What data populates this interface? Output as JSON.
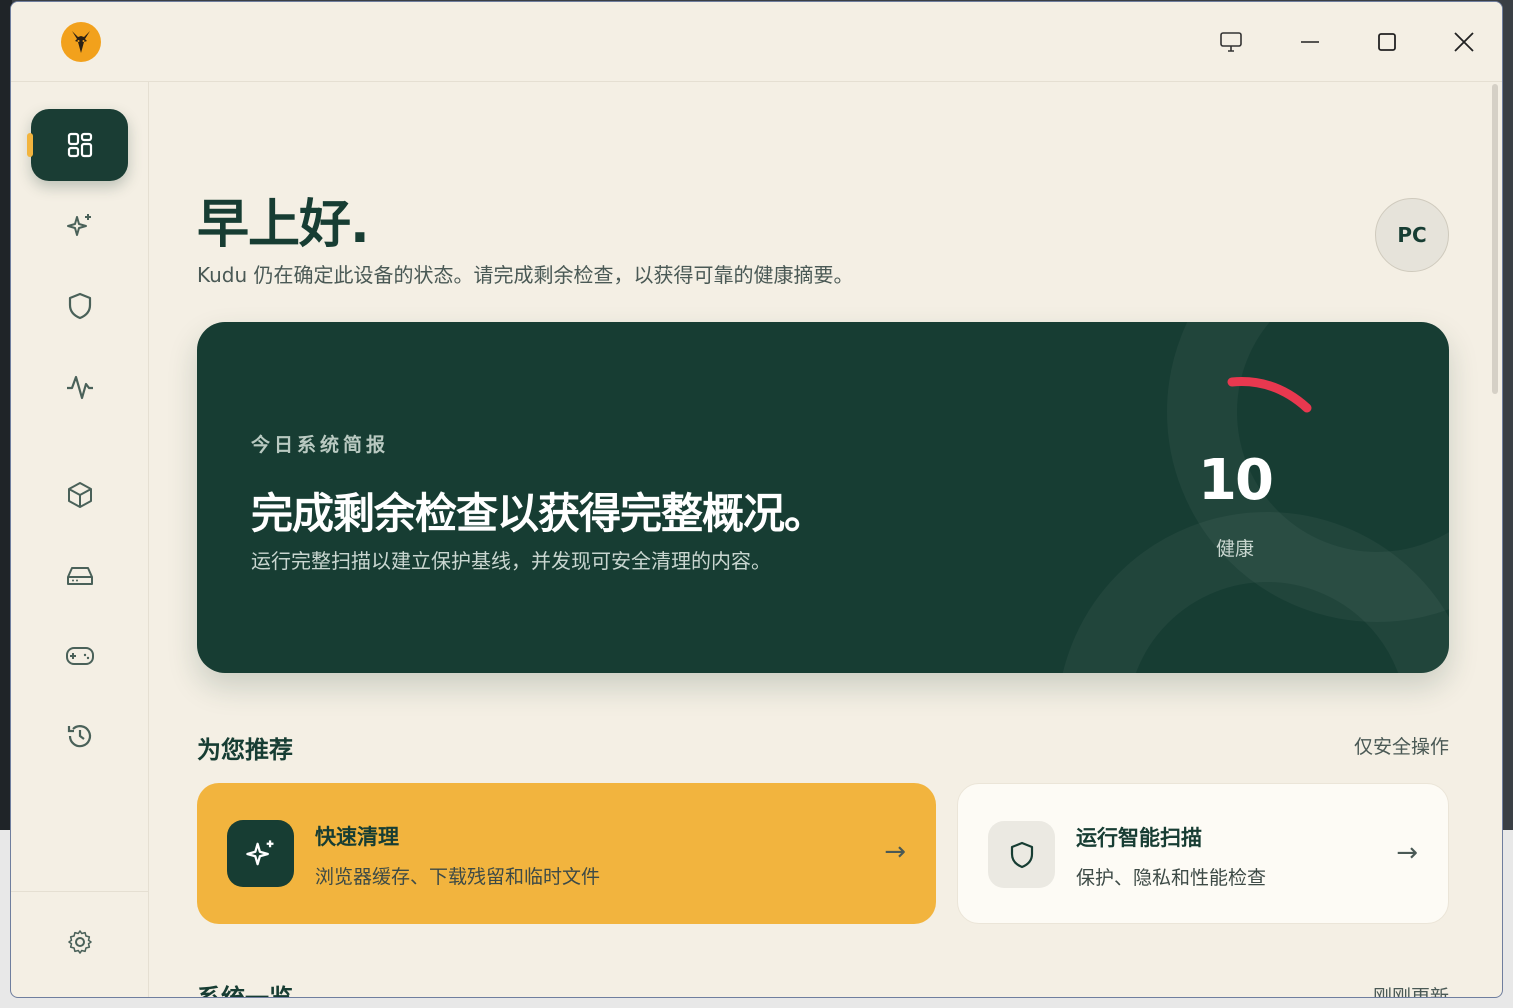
{
  "app": {
    "name": "Kudu"
  },
  "window_controls": {
    "display_icon": "monitor-icon",
    "minimize_icon": "minimize-icon",
    "maximize_icon": "maximize-icon",
    "close_icon": "close-icon"
  },
  "sidebar": {
    "items": [
      {
        "id": "dashboard",
        "icon": "dashboard-grid-icon",
        "active": true
      },
      {
        "id": "clean",
        "icon": "sparkles-icon"
      },
      {
        "id": "security",
        "icon": "shield-icon"
      },
      {
        "id": "performance",
        "icon": "activity-icon"
      },
      {
        "id": "apps",
        "icon": "package-icon"
      },
      {
        "id": "storage",
        "icon": "hard-drive-icon"
      },
      {
        "id": "gaming",
        "icon": "gamepad-icon"
      },
      {
        "id": "history",
        "icon": "history-icon"
      }
    ],
    "settings_icon": "gear-icon"
  },
  "header": {
    "greeting": "早上好.",
    "subtitle": "Kudu 仍在确定此设备的状态。请完成剩余检查，以获得可靠的健康摘要。",
    "avatar_initials": "PC"
  },
  "hero": {
    "kicker": "今日系统简报",
    "title": "完成剩余检查以获得完整概况。",
    "description": "运行完整扫描以建立保护基线，并发现可安全清理的内容。",
    "score": "10",
    "score_label": "健康",
    "score_fraction": 0.1
  },
  "recommendations": {
    "title": "为您推荐",
    "filter_link": "仅安全操作",
    "cards": [
      {
        "title": "快速清理",
        "description": "浏览器缓存、下载残留和临时文件",
        "icon": "sparkles-icon",
        "arrow": "→"
      },
      {
        "title": "运行智能扫描",
        "description": "保护、隐私和性能检查",
        "icon": "shield-icon",
        "arrow": "→"
      }
    ]
  },
  "overview": {
    "title": "系统一览",
    "updated": "刚刚更新"
  },
  "colors": {
    "background": "#f4efe4",
    "primary_dark": "#173d33",
    "accent_yellow": "#f2b43e",
    "accent_red": "#e8384f"
  }
}
